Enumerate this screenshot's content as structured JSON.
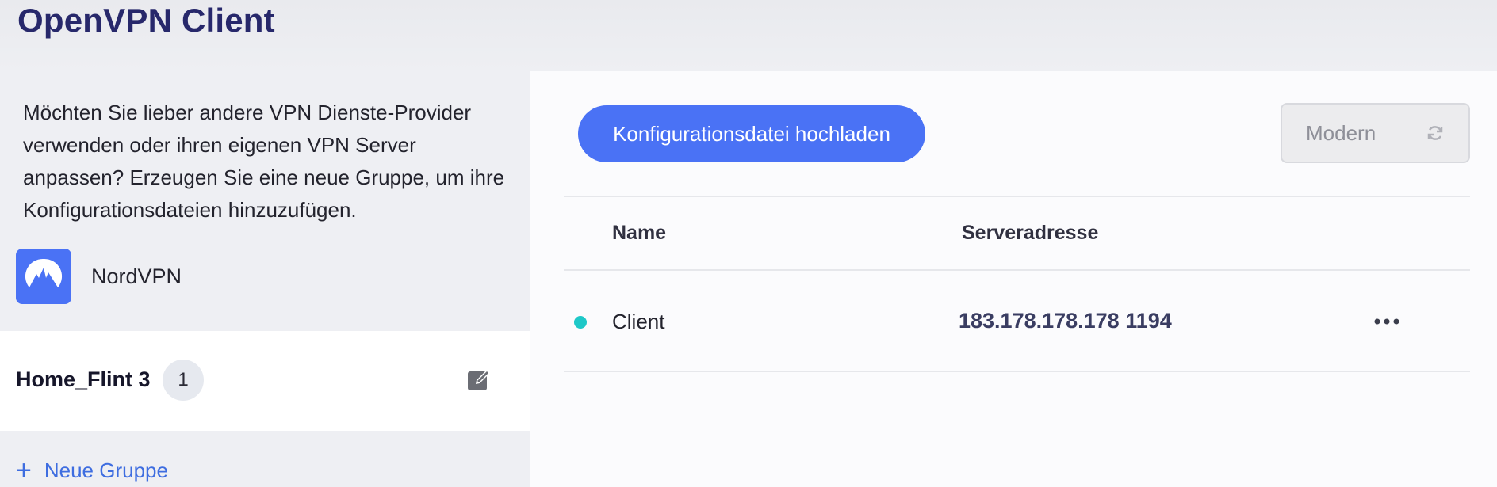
{
  "header": {
    "title": "OpenVPN Client"
  },
  "sidebar": {
    "description": "Möchten Sie lieber andere VPN Dienste-Provider verwenden oder ihren eigenen VPN Server anpassen? Erzeugen Sie eine neue Gruppe, um ihre Konfigurationsdateien hinzuzufügen.",
    "provider": {
      "name": "NordVPN",
      "icon": "nordvpn-logo"
    },
    "group": {
      "name": "Home_Flint 3",
      "count": "1",
      "edit_icon": "edit-icon"
    },
    "new_group_label": "Neue Gruppe"
  },
  "main": {
    "upload_label": "Konfigurationsdatei hochladen",
    "mode": {
      "value": "Modern",
      "icon": "refresh-icon"
    },
    "table": {
      "headers": {
        "name": "Name",
        "address": "Serveradresse"
      },
      "rows": [
        {
          "name": "Client",
          "address": "183.178.178.178 1194",
          "status_color": "#1ec8c8"
        }
      ]
    }
  },
  "colors": {
    "accent": "#4a72f5",
    "title": "#27286b",
    "status_active": "#1ec8c8"
  }
}
